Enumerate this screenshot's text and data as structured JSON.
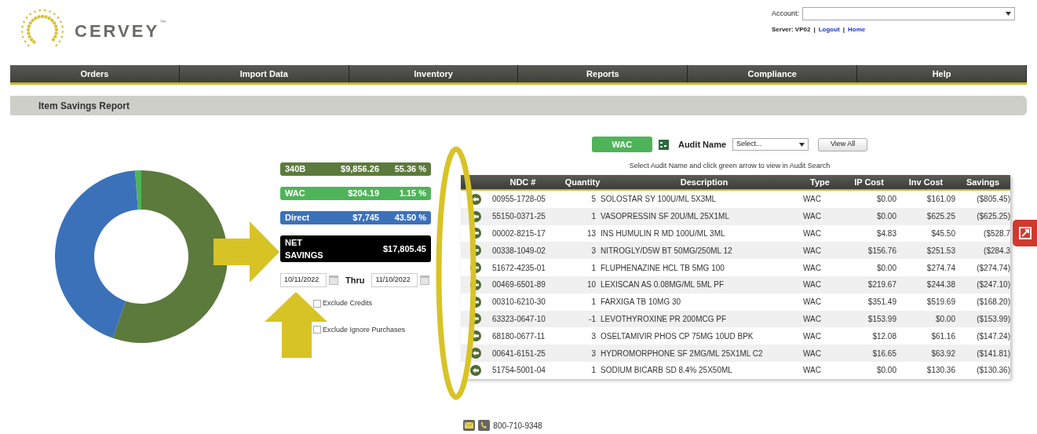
{
  "logo": {
    "text": "CERVEY",
    "mark": "™"
  },
  "account": {
    "label": "Account:",
    "server_label": "Server: VP02",
    "separator": "|",
    "links": [
      "Logout",
      "Home"
    ]
  },
  "nav": [
    "Orders",
    "Import Data",
    "Inventory",
    "Reports",
    "Compliance",
    "Help"
  ],
  "page_title": "Item Savings Report",
  "chart": {
    "chart_data": {
      "type": "donut",
      "categories": [
        "340B",
        "WAC",
        "Direct"
      ],
      "values": [
        55.36,
        1.15,
        43.5
      ]
    }
  },
  "legend": [
    {
      "amount": "$9,856.26",
      "percent": "55.36 %",
      "color": "#5b7a3c"
    },
    {
      "amount": "$204.19",
      "percent": "1.15 %",
      "color": "#4fb35a"
    },
    {
      "amount": "$7,745",
      "percent": "43.50 %",
      "color": "#3b71b9"
    }
  ],
  "net": {
    "label": "NET SAVINGS",
    "amount": "$17,805.45"
  },
  "dates": {
    "from": "10/11/2022",
    "thru_label": "Thru",
    "to": "11/10/2022"
  },
  "options": [
    {
      "label": "Exclude Credits",
      "checked": false
    },
    {
      "label": "Exclude Ignore Purchases",
      "checked": false
    }
  ],
  "toolbar": {
    "type_button": "WAC",
    "audit_label": "Audit Name",
    "audit_placeholder": "Select...",
    "view_all": "View All",
    "hint": "Select Audit Name and click green arrow to view in Audit Search"
  },
  "table": {
    "columns": [
      "NDC #",
      "Quantity",
      "Description",
      "Type",
      "IP Cost",
      "Inv Cost",
      "Savings"
    ],
    "rows": [
      [
        "00955-1728-05",
        "5",
        "SOLOSTAR SY 100U/ML 5X3ML",
        "WAC",
        "$0.00",
        "$161.09",
        "($805.45)"
      ],
      [
        "55150-0371-25",
        "1",
        "VASOPRESSIN SF 20U/ML 25X1ML",
        "WAC",
        "$0.00",
        "$625.25",
        "($625.25)"
      ],
      [
        "00002-8215-17",
        "13",
        "INS HUMULIN R MD 100U/ML 3ML",
        "WAC",
        "$4.83",
        "$45.50",
        "($528.7"
      ],
      [
        "00338-1049-02",
        "3",
        "NITROGLY/D5W BT 50MG/250ML 12",
        "WAC",
        "$156.76",
        "$251.53",
        "($284.3"
      ],
      [
        "51672-4235-01",
        "1",
        "FLUPHENAZINE HCL TB 5MG 100",
        "WAC",
        "$0.00",
        "$274.74",
        "($274.74)"
      ],
      [
        "00469-6501-89",
        "10",
        "LEXISCAN AS 0.08MG/ML 5ML PF",
        "WAC",
        "$219.67",
        "$244.38",
        "($247.10)"
      ],
      [
        "00310-6210-30",
        "1",
        "FARXIGA TB 10MG 30",
        "WAC",
        "$351.49",
        "$519.69",
        "($168.20)"
      ],
      [
        "63323-0647-10",
        "-1",
        "LEVOTHYROXINE PR 200MCG PF",
        "WAC",
        "$153.99",
        "$0.00",
        "($153.99)"
      ],
      [
        "68180-0677-11",
        "3",
        "OSELTAMIVIR PHOS CP 75MG 10UD BPK",
        "WAC",
        "$12.08",
        "$61.16",
        "($147.24)"
      ],
      [
        "00641-6151-25",
        "3",
        "HYDROMORPHONE SF 2MG/ML 25X1ML C2",
        "WAC",
        "$16.65",
        "$63.92",
        "($141.81)"
      ],
      [
        "51754-5001-04",
        "1",
        "SODIUM BICARB SD 8.4% 25X50ML",
        "WAC",
        "$0.00",
        "$130.36",
        "($130.36)"
      ]
    ]
  },
  "footer": {
    "phone": "800-710-9348"
  }
}
